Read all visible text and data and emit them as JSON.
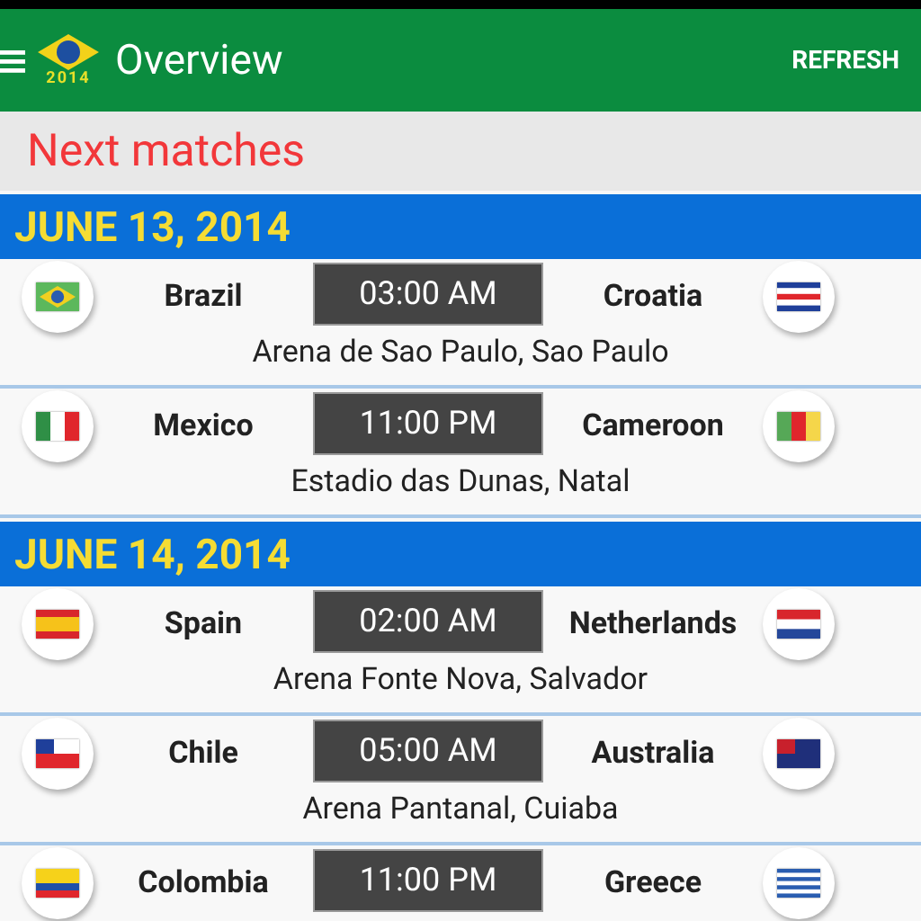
{
  "app_bar": {
    "title": "Overview",
    "logo_year": "2014",
    "action": "REFRESH"
  },
  "section_title": "Next matches",
  "days": [
    {
      "date": "JUNE 13, 2014",
      "matches": [
        {
          "home": {
            "name": "Brazil",
            "kind": "br"
          },
          "time": "03:00 AM",
          "away": {
            "name": "Croatia",
            "kind": "cr"
          },
          "venue": "Arena de Sao Paulo, Sao Paulo"
        },
        {
          "home": {
            "name": "Mexico",
            "kind": "mx"
          },
          "time": "11:00 PM",
          "away": {
            "name": "Cameroon",
            "kind": "cm"
          },
          "venue": "Estadio das Dunas, Natal"
        }
      ]
    },
    {
      "date": "JUNE 14, 2014",
      "matches": [
        {
          "home": {
            "name": "Spain",
            "kind": "es"
          },
          "time": "02:00 AM",
          "away": {
            "name": "Netherlands",
            "kind": "nl"
          },
          "venue": "Arena Fonte Nova, Salvador"
        },
        {
          "home": {
            "name": "Chile",
            "kind": "cl"
          },
          "time": "05:00 AM",
          "away": {
            "name": "Australia",
            "kind": "au"
          },
          "venue": "Arena Pantanal, Cuiaba"
        },
        {
          "home": {
            "name": "Colombia",
            "kind": "co"
          },
          "time": "11:00 PM",
          "away": {
            "name": "Greece",
            "kind": "gr"
          }
        }
      ]
    }
  ]
}
